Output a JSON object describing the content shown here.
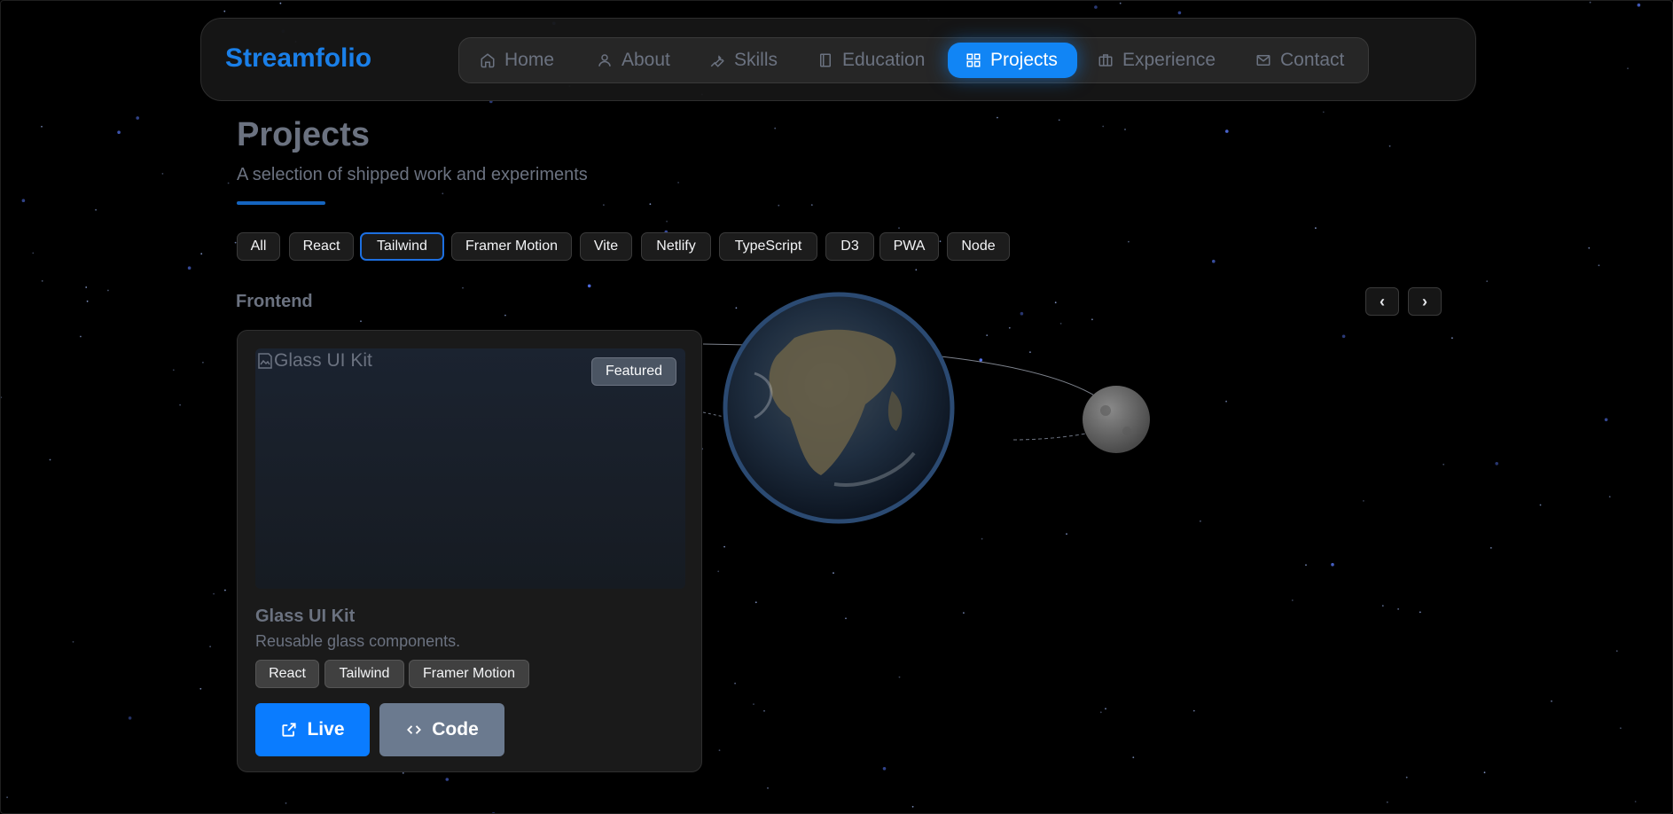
{
  "nav": {
    "brand": "Streamfolio",
    "items": [
      {
        "label": "Home",
        "icon": "home-icon"
      },
      {
        "label": "About",
        "icon": "user-icon"
      },
      {
        "label": "Skills",
        "icon": "wrench-icon"
      },
      {
        "label": "Education",
        "icon": "book-icon"
      },
      {
        "label": "Projects",
        "icon": "grid-icon",
        "active": true
      },
      {
        "label": "Experience",
        "icon": "briefcase-icon"
      },
      {
        "label": "Contact",
        "icon": "mail-icon"
      }
    ]
  },
  "header": {
    "title": "Projects",
    "subtitle": "A selection of shipped work and experiments"
  },
  "filters": {
    "items": [
      "All",
      "React",
      "Tailwind",
      "Framer Motion",
      "Vite",
      "Netlify",
      "TypeScript",
      "D3",
      "PWA",
      "Node"
    ],
    "active": "Tailwind"
  },
  "section": {
    "label": "Frontend",
    "prev": "‹",
    "next": "›"
  },
  "card": {
    "image_alt": "Glass UI Kit",
    "badge": "Featured",
    "title": "Glass UI Kit",
    "description": "Reusable glass components.",
    "tags": [
      "React",
      "Tailwind",
      "Framer Motion"
    ],
    "live_label": "Live",
    "code_label": "Code"
  },
  "colors": {
    "accent": "#1185f5",
    "brand": "#1a7fe8",
    "background": "#000000",
    "code_button": "#6b7a8f"
  }
}
